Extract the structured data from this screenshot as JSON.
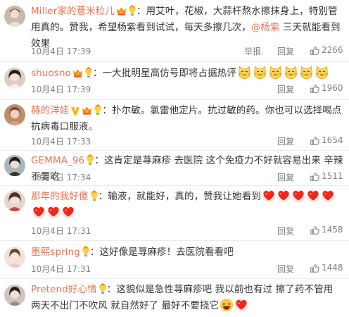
{
  "colors": {
    "username": "#eb7350",
    "meta_text": "#808080",
    "divider": "#ececec"
  },
  "comments": [
    {
      "user": "Miller家的薏米粒儿",
      "text_a": "：用艾叶，花椒，大蒜杆熬水擦抹身上，特别管用真的。赞我，希望杨紫看到试试，每天多擦几次，",
      "mention": "@杨紫",
      "text_b": " 三天就能看到效果",
      "time": "10月4日 17:39",
      "report": "举报",
      "reply": "回复",
      "likes": "2266"
    },
    {
      "user": "shuosno",
      "text_a": "：一大批明星高仿号即将占据热评",
      "time": "10月4日 17:39",
      "reply": "回复",
      "likes": "1960"
    },
    {
      "user": "赫的洋娃",
      "text_a": "：扑尔敏。氯雷他定片。抗过敏的药。你也可以选择喝点抗病毒口服液。",
      "time": "10月4日 17:33",
      "reply": "回复",
      "likes": "1654"
    },
    {
      "user": "GEMMA_96",
      "text_a": "：这肯定是荨麻疹 去医院 这个免疫力不好就容易出来 辛辣不要吃",
      "time": "10月4日 17:34",
      "reply": "回复",
      "likes": "1511"
    },
    {
      "user": "那年的我好傻",
      "text_a": "：输液，就能好，真的，赞我让她看到",
      "time": "10月4日 17:31",
      "reply": "回复",
      "likes": "1458"
    },
    {
      "user": "墨熙spring",
      "text_a": "：这好像是荨麻疹！去医院看看吧",
      "time": "10月4日 17:31",
      "reply": "回复",
      "likes": "1448"
    },
    {
      "user": "Pretend好心情",
      "text_a": "：这貌似是急性荨麻疹吧 我以前也有过 擦了药不管用 两天不出门不吹风 就自然好了 最好不要挠它"
    }
  ],
  "icons": {
    "badge_icon": "vip-badge-icon",
    "like_icon": "thumbs-up-icon",
    "cat_emoji": "cat-face-emoji-icon",
    "heart_emoji": "heart-emoji-icon",
    "laugh_emoji": "laughing-face-emoji-icon"
  }
}
